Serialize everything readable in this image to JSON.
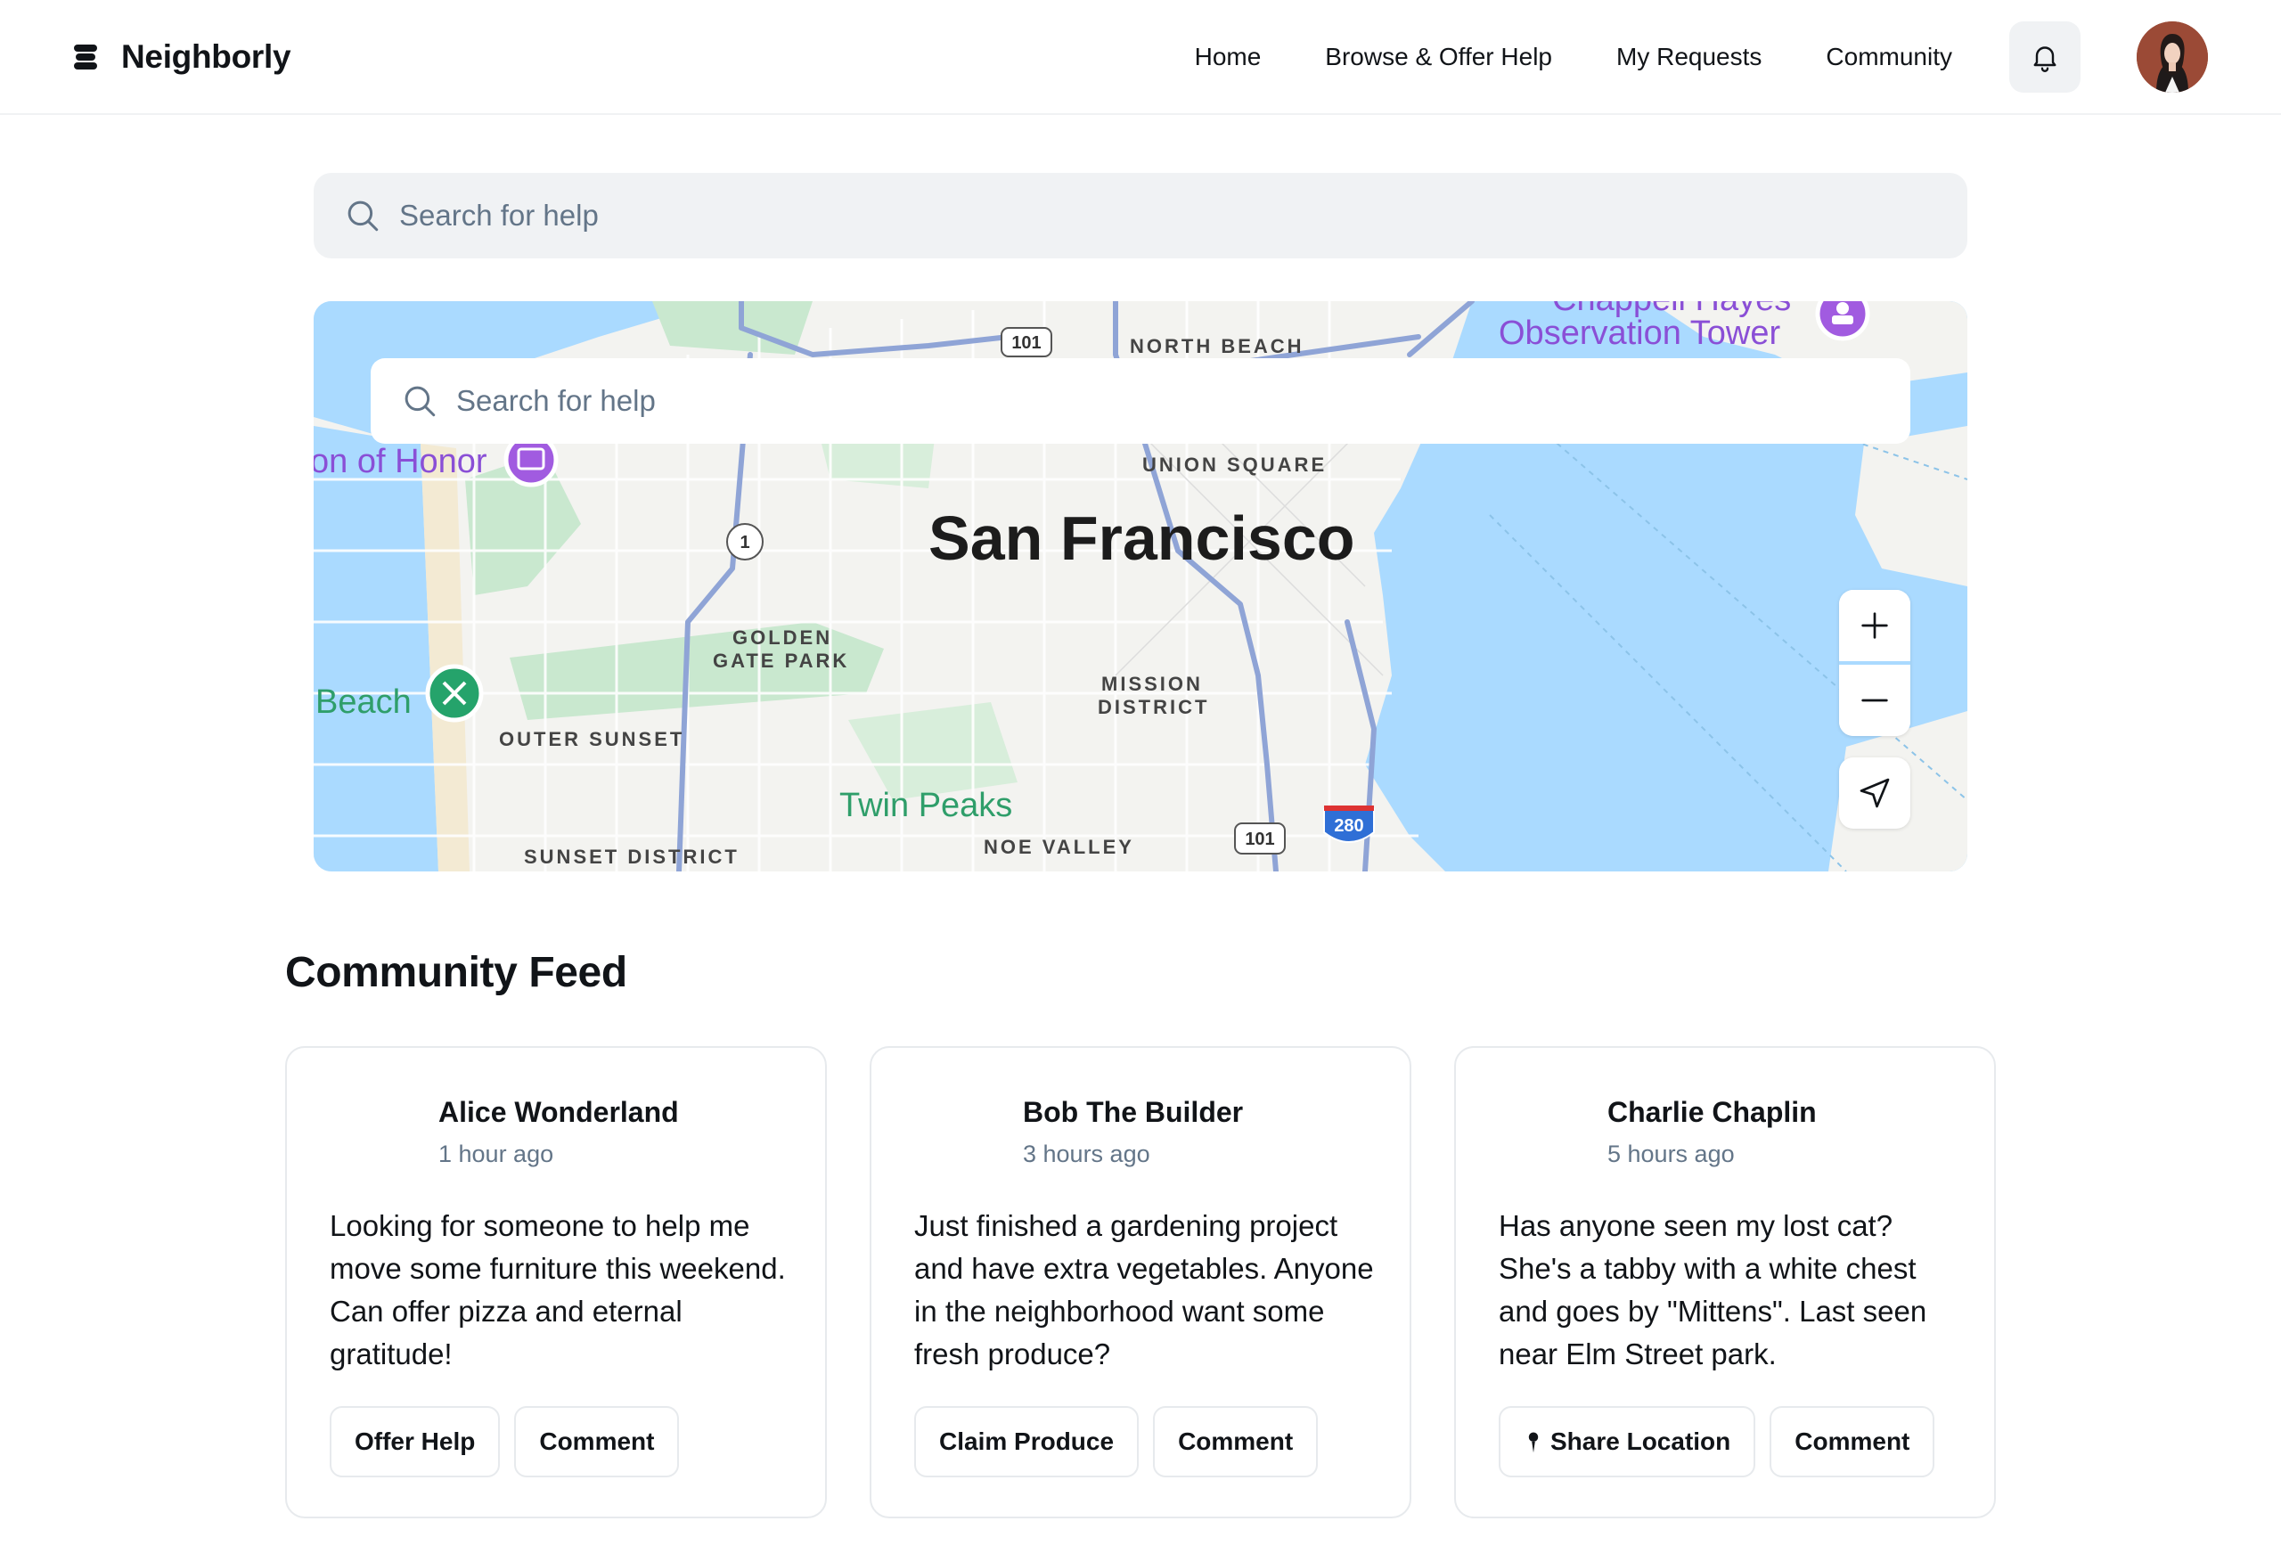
{
  "brand": {
    "name": "Neighborly",
    "logo_icon": "stack-logo-icon"
  },
  "nav": {
    "items": [
      {
        "label": "Home"
      },
      {
        "label": "Browse & Offer Help"
      },
      {
        "label": "My Requests"
      },
      {
        "label": "Community"
      }
    ],
    "notifications_icon": "bell-icon"
  },
  "search": {
    "placeholder": "Search for help",
    "value": ""
  },
  "map": {
    "search_placeholder": "Search for help",
    "labels": {
      "city": "San Francisco",
      "north_beach": "NORTH BEACH",
      "union_square": "UNION SQUARE",
      "golden_gate_park_1": "GOLDEN",
      "golden_gate_park_2": "GATE PARK",
      "mission_1": "MISSION",
      "mission_2": "DISTRICT",
      "outer_sunset": "OUTER SUNSET",
      "sunset_district": "SUNSET DISTRICT",
      "twin_peaks": "Twin Peaks",
      "noe_valley": "NOE VALLEY",
      "observation_tower": "Observation Tower",
      "chappell_hayes": "Chappell Hayes",
      "legion_of_honor": "on of Honor",
      "beach": "Beach",
      "hwy_101_north": "101",
      "hwy_1": "1",
      "hwy_101_south": "101",
      "hwy_280": "280"
    },
    "controls": {
      "zoom_in_icon": "plus-icon",
      "zoom_out_icon": "minus-icon",
      "locate_icon": "navigation-arrow-icon"
    },
    "colors": {
      "water": "#aadaff",
      "land": "#f5f5f5",
      "park": "#c8e6c9",
      "highway": "#8fa4d6"
    }
  },
  "feed": {
    "title": "Community Feed",
    "posts": [
      {
        "author": "Alice Wonderland",
        "time": "1 hour ago",
        "text": "Looking for someone to help me move some furniture this weekend. Can offer pizza and eternal gratitude!",
        "actions": [
          {
            "label": "Offer Help"
          },
          {
            "label": "Comment"
          }
        ]
      },
      {
        "author": "Bob The Builder",
        "time": "3 hours ago",
        "text": "Just finished a gardening project and have extra vegetables. Anyone in the neighborhood want some fresh produce?",
        "actions": [
          {
            "label": "Claim Produce"
          },
          {
            "label": "Comment"
          }
        ]
      },
      {
        "author": "Charlie Chaplin",
        "time": "5 hours ago",
        "text": "Has anyone seen my lost cat? She's a tabby with a white chest and goes by \"Mittens\". Last seen near Elm Street park.",
        "actions": [
          {
            "label": "Share Location",
            "icon": "pin-icon"
          },
          {
            "label": "Comment"
          }
        ]
      }
    ]
  }
}
